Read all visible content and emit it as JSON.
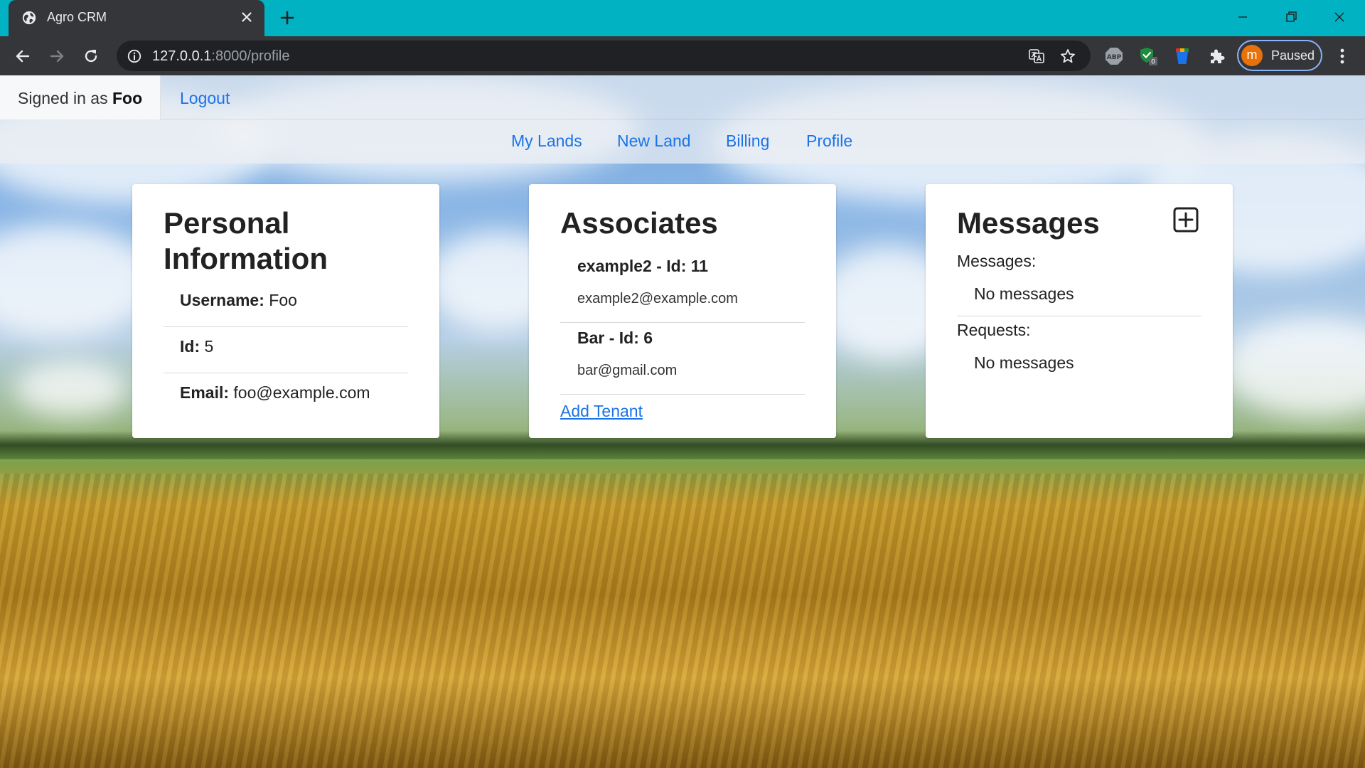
{
  "browser": {
    "tab_title": "Agro CRM",
    "url_host": "127.0.0.1",
    "url_rest": ":8000/profile",
    "profile_initial": "m",
    "profile_status": "Paused",
    "ext_badge": "0",
    "abp_label": "ABP"
  },
  "header": {
    "signed_in_prefix": "Signed in as ",
    "username": "Foo",
    "logout": "Logout"
  },
  "nav": {
    "items": [
      "My Lands",
      "New Land",
      "Billing",
      "Profile"
    ]
  },
  "personal": {
    "title_line1": "Personal",
    "title_line2": "Information",
    "username_label": "Username:",
    "username_value": "Foo",
    "id_label": "Id:",
    "id_value": "5",
    "email_label": "Email:",
    "email_value": "foo@example.com"
  },
  "associates": {
    "title": "Associates",
    "items": [
      {
        "name": "example2 - Id: 11",
        "email": "example2@example.com"
      },
      {
        "name": "Bar - Id: 6",
        "email": "bar@gmail.com"
      }
    ],
    "add_tenant": "Add Tenant"
  },
  "messages": {
    "title": "Messages",
    "messages_label": "Messages:",
    "messages_empty": "No messages",
    "requests_label": "Requests:",
    "requests_empty": "No messages"
  },
  "colors": {
    "tab_bar": "#00b2c2",
    "chrome_dark": "#35363a",
    "link": "#1a73e8",
    "avatar": "#e8710a"
  }
}
